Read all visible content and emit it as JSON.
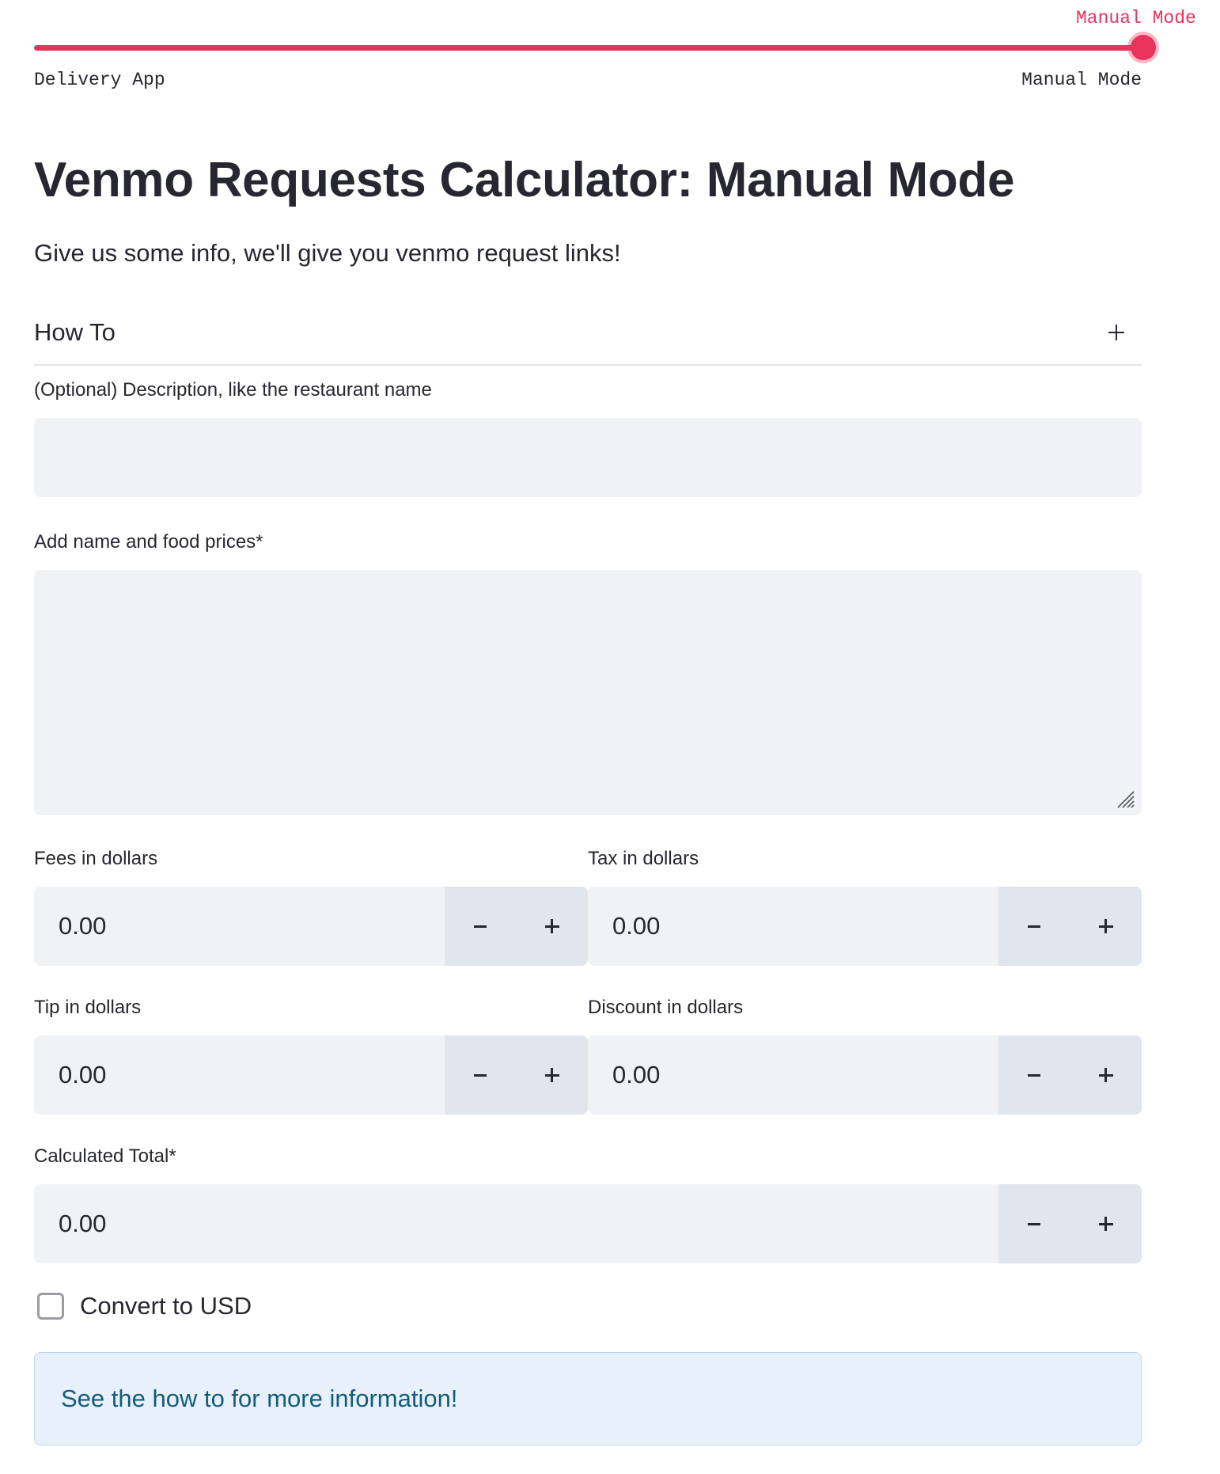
{
  "slider": {
    "current_value": "Manual Mode",
    "min_label": "Delivery App",
    "max_label": "Manual Mode",
    "selected_fraction": 1.0,
    "accent_color": "#e8335d"
  },
  "header": {
    "title": "Venmo Requests Calculator: Manual Mode",
    "subtitle": "Give us some info, we'll give you venmo request links!"
  },
  "expander": {
    "label": "How To",
    "icon": "plus-icon"
  },
  "form": {
    "description": {
      "label": "(Optional) Description, like the restaurant name",
      "value": ""
    },
    "prices": {
      "label": "Add name and food prices*",
      "value": ""
    },
    "fees": {
      "label": "Fees in dollars",
      "value": "0.00"
    },
    "tax": {
      "label": "Tax in dollars",
      "value": "0.00"
    },
    "tip": {
      "label": "Tip in dollars",
      "value": "0.00"
    },
    "discount": {
      "label": "Discount in dollars",
      "value": "0.00"
    },
    "total": {
      "label": "Calculated Total*",
      "value": "0.00"
    },
    "convert_usd": {
      "label": "Convert to USD",
      "checked": false
    }
  },
  "info": {
    "message": "See the how to for more information!"
  }
}
